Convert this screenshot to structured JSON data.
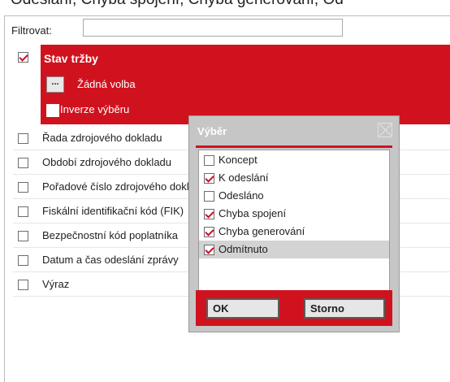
{
  "top_partial_text": "Odeslání, Chyba spojení, Chyba generování, Od",
  "filter": {
    "label": "Filtrovat:",
    "value": "",
    "placeholder": ""
  },
  "condition": {
    "title": "Stav tržby",
    "checked": true,
    "dots_label": "...",
    "choice_label": "Žádná volba",
    "inverse_label": "Inverze výběru"
  },
  "fields": [
    {
      "label": "Řada zdrojového dokladu"
    },
    {
      "label": "Období zdrojového dokladu"
    },
    {
      "label": "Pořadové číslo zdrojového dokladu"
    },
    {
      "label": "Fiskální identifikační kód (FIK)"
    },
    {
      "label": "Bezpečnostní kód poplatníka"
    },
    {
      "label": "Datum a čas odeslání zprávy"
    },
    {
      "label": "Výraz"
    }
  ],
  "dialog": {
    "title": "Výběr",
    "items": [
      {
        "label": "Koncept",
        "checked": false,
        "selected": false
      },
      {
        "label": "K odeslání",
        "checked": true,
        "selected": false
      },
      {
        "label": "Odesláno",
        "checked": false,
        "selected": false
      },
      {
        "label": "Chyba spojení",
        "checked": true,
        "selected": false
      },
      {
        "label": "Chyba generování",
        "checked": true,
        "selected": false
      },
      {
        "label": "Odmítnuto",
        "checked": true,
        "selected": true
      }
    ],
    "ok_label": "OK",
    "cancel_label": "Storno"
  },
  "colors": {
    "accent": "#d0121f",
    "selection": "#d3d3d3",
    "dialog_bg": "#c6c6c6"
  }
}
